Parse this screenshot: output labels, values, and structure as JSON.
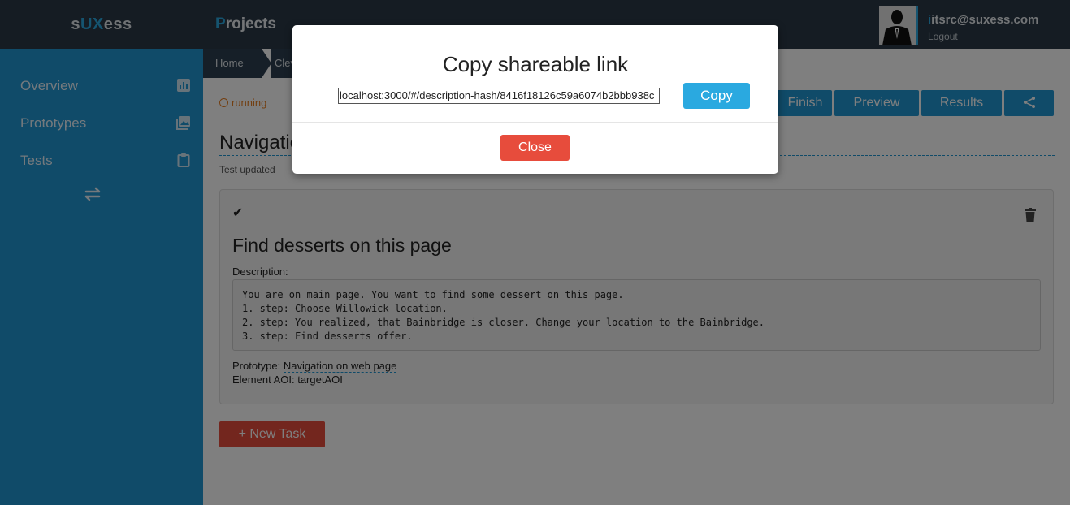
{
  "brand": {
    "part1": "s",
    "part2": "UX",
    "part3": "ess"
  },
  "topnav": {
    "first_letter": "P",
    "rest": "rojects"
  },
  "user": {
    "email_first": "i",
    "email_rest": "itsrc@suxess.com",
    "logout": "Logout"
  },
  "sidebar": {
    "items": [
      {
        "label": "Overview",
        "icon": "bar-chart-icon"
      },
      {
        "label": "Prototypes",
        "icon": "images-icon"
      },
      {
        "label": "Tests",
        "icon": "clipboard-icon"
      }
    ],
    "swap_icon": "swap-arrows-icon"
  },
  "breadcrumb": {
    "home": "Home",
    "next": "Clev"
  },
  "status": {
    "label": "running"
  },
  "actions": {
    "finish": "Finish",
    "preview": "Preview",
    "results": "Results",
    "share_icon": "share-icon"
  },
  "page": {
    "title": "Navigation",
    "updated": "Test updated"
  },
  "task": {
    "title": "Find desserts on this page",
    "description_label": "Description:",
    "description": "You are on main page. You want to find some dessert on this page.\n1. step: Choose Willowick location.\n2. step: You realized, that Bainbridge is closer. Change your location to the Bainbridge.\n3. step: Find desserts offer.",
    "prototype_label": "Prototype: ",
    "prototype_value": "Navigation on web page",
    "aoi_label": "Element AOI: ",
    "aoi_value": "targetAOI"
  },
  "new_task": "+ New Task",
  "modal": {
    "title": "Copy shareable link",
    "link": "localhost:3000/#/description-hash/8416f18126c59a6074b2bbb938c",
    "copy": "Copy",
    "close": "Close"
  },
  "colors": {
    "accent": "#2196d3",
    "topbar": "#2b3946",
    "danger": "#e74c3c",
    "running": "#e67e22"
  }
}
